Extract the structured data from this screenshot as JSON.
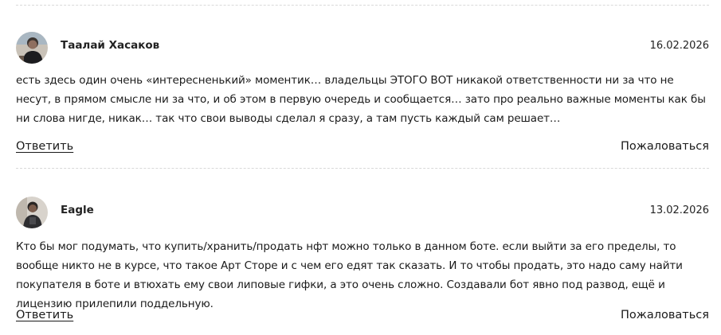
{
  "comments": [
    {
      "author": "Таалай Хасаков",
      "date": "16.02.2026",
      "text": "есть здесь один очень «интересненький» моментик… владельцы ЭТОГО ВОТ никакой ответственности ни за что не несут, в прямом смысле ни за что, и об этом в первую очередь и сообщается… зато про реально важные моменты как бы ни слова нигде, никак… так что свои выводы сделал я сразу, а там пусть каждый сам решает…",
      "reply_label": "Ответить",
      "report_label": "Пожаловаться",
      "avatar_icon": "user-photo-avatar"
    },
    {
      "author": "Eagle",
      "date": "13.02.2026",
      "text": "Кто бы мог подумать, что купить/хранить/продать нфт можно только в данном боте. если выйти за его пределы, то вообще никто не в курсе, что такое Арт Сторе и с чем его едят так сказать. И то чтобы продать, это надо саму найти покупателя в боте и втюхать ему свои липовые гифки, а это очень сложно. Создавали бот явно под развод, ещё и лицензию прилепили поддельную.",
      "reply_label": "Ответить",
      "report_label": "Пожаловаться",
      "avatar_icon": "user-photo-avatar"
    }
  ],
  "colors": {
    "text": "#1a1a1a",
    "divider": "#d9d9d9",
    "background": "#ffffff"
  }
}
